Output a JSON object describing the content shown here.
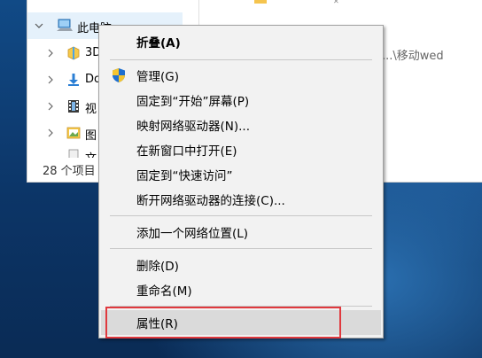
{
  "explorer": {
    "nav": {
      "this_pc": "此电脑",
      "items": [
        {
          "label": "3D",
          "icon": "3d-objects-icon"
        },
        {
          "label": "Do",
          "icon": "downloads-icon"
        },
        {
          "label": "视",
          "icon": "videos-icon"
        },
        {
          "label": "图",
          "icon": "pictures-icon"
        },
        {
          "label": "文",
          "icon": "documents-icon"
        }
      ]
    },
    "status": "28 个项目",
    "path_fragment": "...\\移动wed"
  },
  "context_menu": {
    "items": [
      {
        "label": "折叠(A)",
        "bold": true
      },
      {
        "label": "管理(G)",
        "icon": "shield-icon"
      },
      {
        "label": "固定到“开始”屏幕(P)"
      },
      {
        "label": "映射网络驱动器(N)..."
      },
      {
        "label": "在新窗口中打开(E)"
      },
      {
        "label": "固定到“快速访问”"
      },
      {
        "label": "断开网络驱动器的连接(C)..."
      },
      {
        "label": "添加一个网络位置(L)"
      },
      {
        "label": "删除(D)"
      },
      {
        "label": "重命名(M)"
      },
      {
        "label": "属性(R)",
        "highlighted": true
      }
    ]
  },
  "colors": {
    "highlight_box": "#e0393e",
    "menu_background": "#f2f2f2",
    "nav_selection": "#e5f1fb"
  }
}
